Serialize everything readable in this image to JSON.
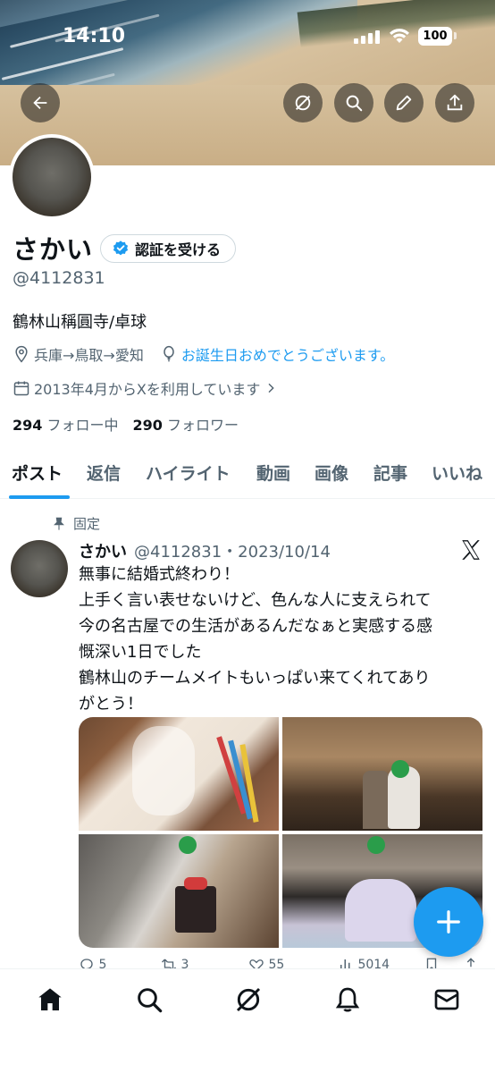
{
  "status_bar": {
    "time": "14:10",
    "battery": "100"
  },
  "profile": {
    "name": "さかい",
    "verify_label": "認証を受ける",
    "handle": "@4112831",
    "bio": "鶴林山稱圓寺/卓球",
    "location": "兵庫→鳥取→愛知",
    "birthday_link": "お誕生日おめでとうございます。",
    "joined": "2013年4月からXを利用しています",
    "following_count": "294",
    "following_label": "フォロー中",
    "followers_count": "290",
    "followers_label": "フォロワー"
  },
  "tabs": [
    "ポスト",
    "返信",
    "ハイライト",
    "動画",
    "画像",
    "記事",
    "いいね"
  ],
  "post": {
    "pinned_label": "固定",
    "author": "さかい",
    "meta": "@4112831・2023/10/14",
    "lines": [
      "無事に結婚式終わり！",
      "上手く言い表せないけど、色んな人に支えられて",
      "今の名古屋での生活があるんだなぁと実感する感",
      "慨深い1日でした",
      "鶴林山のチームメイトもいっぱい来てくれてあり",
      "がとう！"
    ],
    "actions": {
      "replies": "5",
      "reposts": "3",
      "likes": "55",
      "views": "5014"
    }
  },
  "icons": {
    "back": "back-arrow-icon",
    "grok": "grok-icon",
    "search": "search-icon",
    "edit": "pencil-icon",
    "share": "share-icon",
    "home": "home-icon",
    "explore": "search-icon",
    "notifications": "bell-icon",
    "messages": "mail-icon"
  },
  "colors": {
    "accent": "#1d9bf0",
    "text": "#0f1419",
    "secondary": "#536471"
  }
}
